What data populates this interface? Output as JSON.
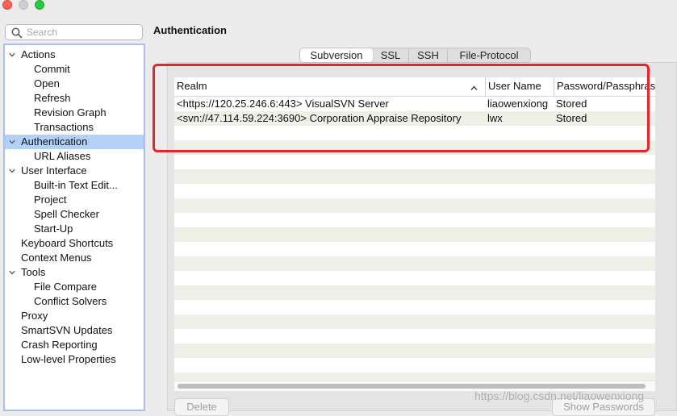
{
  "search": {
    "placeholder": "Search"
  },
  "sidebar": {
    "items": [
      {
        "label": "Actions",
        "level": 0,
        "expanded": true
      },
      {
        "label": "Commit",
        "level": 1
      },
      {
        "label": "Open",
        "level": 1
      },
      {
        "label": "Refresh",
        "level": 1
      },
      {
        "label": "Revision Graph",
        "level": 1
      },
      {
        "label": "Transactions",
        "level": 1
      },
      {
        "label": "Authentication",
        "level": 0,
        "expanded": true,
        "selected": true
      },
      {
        "label": "URL Aliases",
        "level": 1
      },
      {
        "label": "User Interface",
        "level": 0,
        "expanded": true
      },
      {
        "label": "Built-in Text Edit...",
        "level": 1
      },
      {
        "label": "Project",
        "level": 1
      },
      {
        "label": "Spell Checker",
        "level": 1
      },
      {
        "label": "Start-Up",
        "level": 1
      },
      {
        "label": "Keyboard Shortcuts",
        "level": 0
      },
      {
        "label": "Context Menus",
        "level": 0
      },
      {
        "label": "Tools",
        "level": 0,
        "expanded": true
      },
      {
        "label": "File Compare",
        "level": 1
      },
      {
        "label": "Conflict Solvers",
        "level": 1
      },
      {
        "label": "Proxy",
        "level": 0
      },
      {
        "label": "SmartSVN Updates",
        "level": 0
      },
      {
        "label": "Crash Reporting",
        "level": 0
      },
      {
        "label": "Low-level Properties",
        "level": 0
      }
    ]
  },
  "main": {
    "heading": "Authentication",
    "tabs": [
      {
        "label": "Subversion",
        "active": true
      },
      {
        "label": "SSL"
      },
      {
        "label": "SSH"
      },
      {
        "label": "File-Protocol"
      }
    ],
    "table": {
      "columns": [
        "Realm",
        "User Name",
        "Password/Passphras"
      ],
      "sort_indicator": "^",
      "rows": [
        [
          "<https://120.25.246.6:443> VisualSVN Server",
          "liaowenxiong",
          "Stored"
        ],
        [
          "<svn://47.114.59.224:3690> Corporation Appraise Repository",
          "lwx",
          "Stored"
        ]
      ]
    },
    "buttons": {
      "delete": "Delete",
      "show_passwords": "Show Passwords"
    }
  },
  "watermark": "https://blog.csdn.net/liaowenxiong",
  "colors": {
    "selection": "#b3d1f7",
    "highlight_box": "#e8242b",
    "row_stripe": "#eef0e7",
    "tree_border": "#a9bff0"
  }
}
